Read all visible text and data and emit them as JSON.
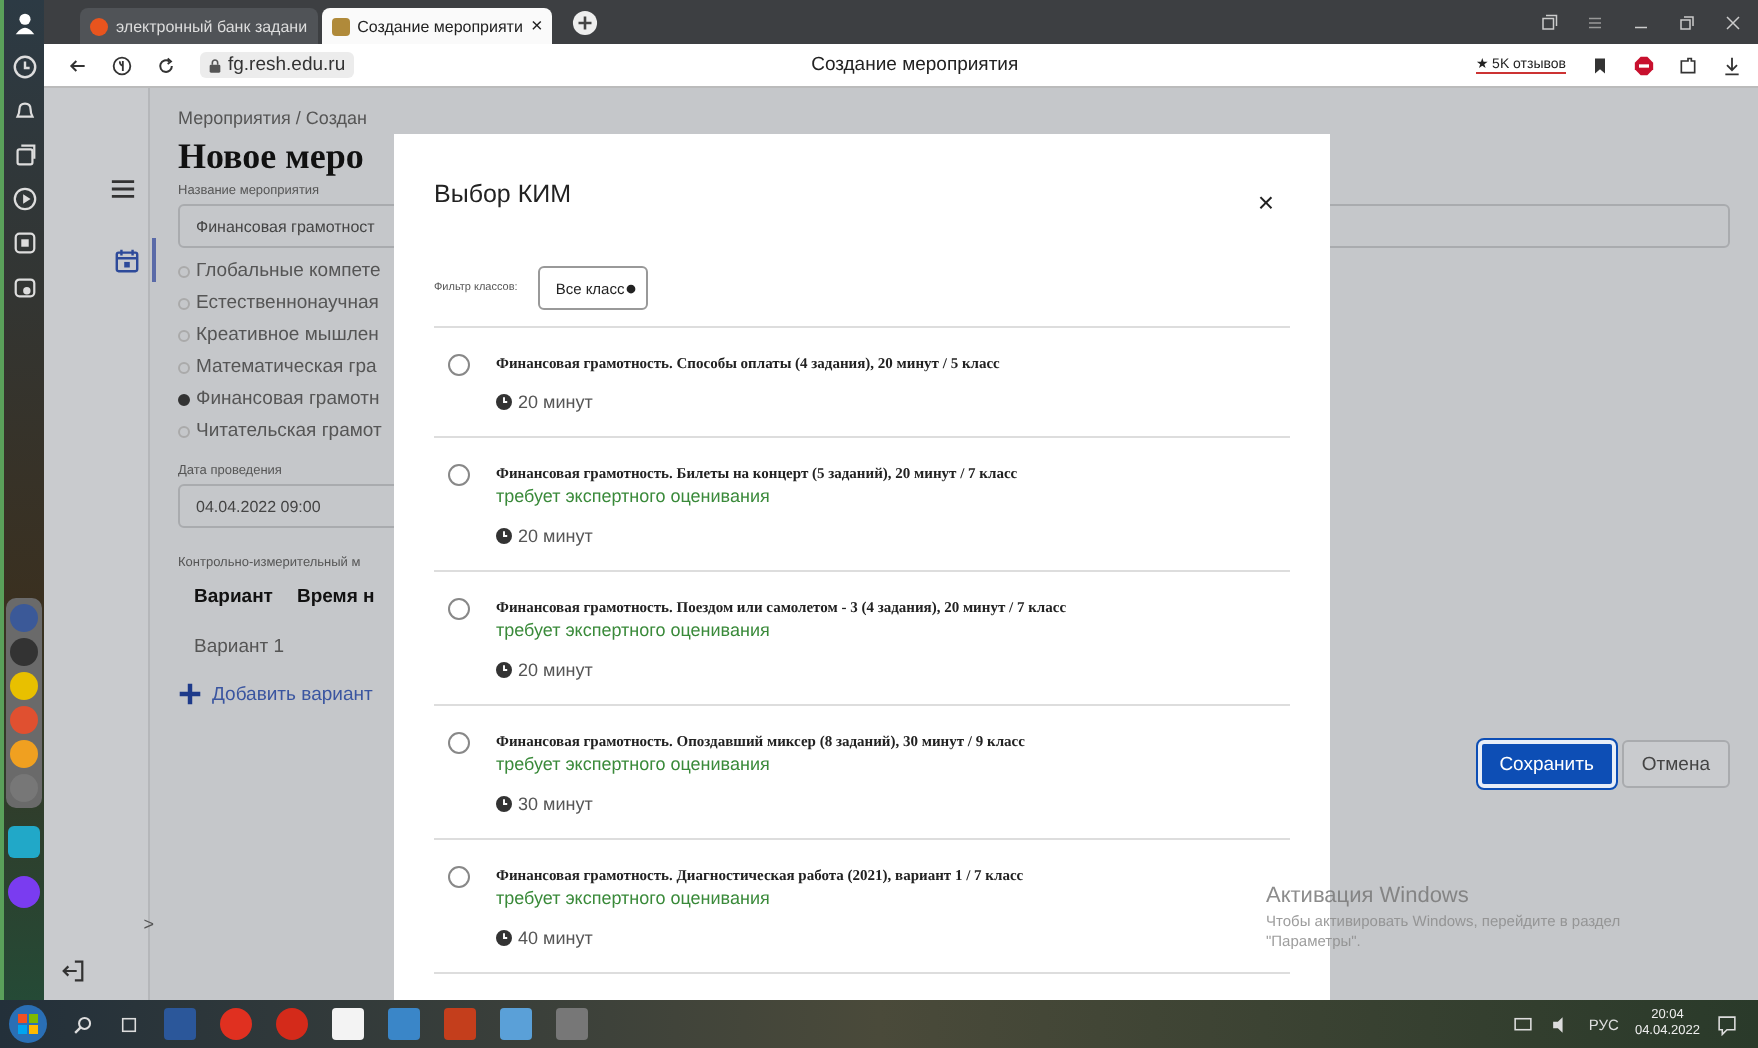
{
  "browser": {
    "tabs": [
      {
        "title": "электронный банк задани",
        "selected": false
      },
      {
        "title": "Создание мероприяти",
        "selected": true,
        "close": "×"
      }
    ],
    "address": "fg.resh.edu.ru",
    "page_title": "Создание мероприятия",
    "reviews": "★ 5K отзывов"
  },
  "page": {
    "breadcrumb": "Мероприятия / Создан",
    "title": "Новое меро",
    "name_label": "Название мероприятия",
    "name_value": "Финансовая грамотност",
    "categories": [
      {
        "label": "Глобальные компете",
        "selected": false
      },
      {
        "label": "Естественнонаучная",
        "selected": false
      },
      {
        "label": "Креативное мышлен",
        "selected": false
      },
      {
        "label": "Математическая гра",
        "selected": false
      },
      {
        "label": "Финансовая грамотн",
        "selected": true
      },
      {
        "label": "Читательская грамот",
        "selected": false
      }
    ],
    "date_label": "Дата проведения",
    "date_value": "04.04.2022 09:00",
    "kim_label": "Контрольно-измерительный м",
    "variant_columns": [
      "Вариант",
      "Время н"
    ],
    "variants": [
      "Вариант 1"
    ],
    "add_variant": "Добавить вариант",
    "collapse": ">",
    "buttons": [
      {
        "label": "Сохранить",
        "kind": "primary"
      },
      {
        "label": "Отмена",
        "kind": "secondary"
      }
    ]
  },
  "modal": {
    "title": "Выбор КИМ",
    "close": "×",
    "filter_label": "Фильтр классов:",
    "filter_value": "Все класс",
    "items": [
      {
        "title": "Финансовая грамотность. Способы оплаты (4 задания), 20 минут / 5 класс",
        "duration": "20 минут",
        "selected": false
      },
      {
        "title": "Финансовая грамотность. Билеты на концерт (5 заданий), 20 минут / 7 класс",
        "note": "требует экспертного оценивания",
        "duration": "20 минут",
        "selected": false
      },
      {
        "title": "Финансовая грамотность. Поездом или самолетом - 3 (4 задания), 20 минут / 7 класс",
        "note": "требует экспертного оценивания",
        "duration": "20 минут",
        "selected": false
      },
      {
        "title": "Финансовая грамотность. Опоздавший миксер (8 заданий), 30 минут / 9 класс",
        "note": "требует экспертного оценивания",
        "duration": "30 минут",
        "selected": false
      },
      {
        "title": "Финансовая грамотность. Диагностическая работа (2021), вариант 1 / 7 класс",
        "note": "требует экспертного оценивания",
        "duration": "40 минут",
        "selected": false
      }
    ]
  },
  "os": {
    "activation_title": "Активация Windows",
    "activation_text": "Чтобы активировать Windows, перейдите в раздел \"Параметры\".",
    "language": "РУС",
    "time": "20:04",
    "date": "04.04.2022"
  }
}
